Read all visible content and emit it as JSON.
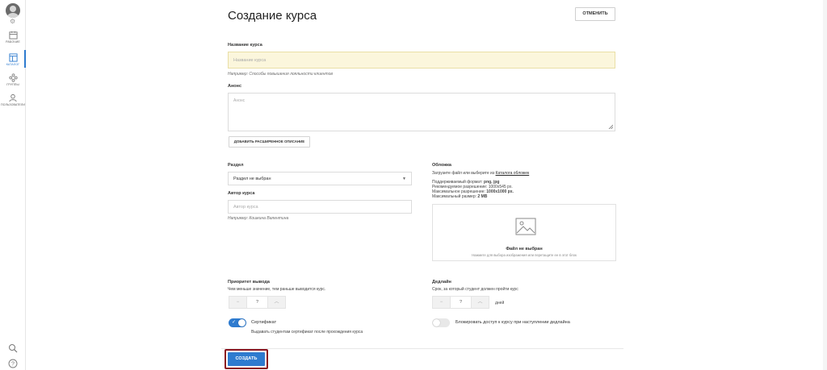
{
  "sidebar": {
    "items": [
      {
        "label": "РАБОЧИЕ",
        "icon": "calendar-icon"
      },
      {
        "label": "КАТАЛОГ",
        "icon": "catalog-icon",
        "active": true
      },
      {
        "label": "ГРУППЫ",
        "icon": "groups-icon"
      },
      {
        "label": "ПОЛЬЗОВАТЕЛИ",
        "icon": "users-icon"
      }
    ]
  },
  "header": {
    "title": "Создание курса",
    "cancel_label": "ОТМЕНИТЬ"
  },
  "course_name": {
    "label": "Название курса",
    "placeholder": "Название курса",
    "hint": "Например: Способы повышения лояльности клиентов"
  },
  "announce": {
    "label": "Анонс",
    "placeholder": "Анонс",
    "add_description_label": "ДОБАВИТЬ РАСШИРЕННОЕ ОПИСАНИЕ"
  },
  "section": {
    "label": "Раздел",
    "value": "Раздел не выбран"
  },
  "author": {
    "label": "Автор курса",
    "placeholder": "Автор курса",
    "hint": "Например: Кошкина Валентина"
  },
  "cover": {
    "label": "Обложка",
    "upload_text": "Загрузите файл или выберите из",
    "catalog_link": "Каталога обложек",
    "format_label": "Поддерживаемый формат:",
    "format_value": "png, jpg",
    "recommended": "Рекомендуемое разрешение: 1000х545 px.",
    "max_resolution_label": "Максимальное разрешение:",
    "max_resolution_value": "1000х1000 px.",
    "max_size_label": "Максимальный размер:",
    "max_size_value": "2 MB",
    "no_file": "Файл не выбран",
    "drop_hint": "Нажмите для выбора изображения или перетащите ее в этот блок"
  },
  "priority": {
    "label": "Приоритет вывода",
    "description": "Чем меньше значение, тем раньше выводится курс.",
    "value": "?"
  },
  "deadline": {
    "label": "Дедлайн",
    "description": "Срок, за который студент должен пройти курс",
    "value": "?",
    "unit": "дней"
  },
  "certificate": {
    "label": "Сертификат",
    "enabled": true,
    "description": "Выдавать студентам сертификат после прохождения курса"
  },
  "block_access": {
    "label": "Блокировать доступ к курсу при наступлении дедлайна",
    "enabled": false
  },
  "actions": {
    "create_label": "СОЗДАТЬ"
  },
  "colors": {
    "accent": "#2e7bcf",
    "highlight_input": "#fbf6dc",
    "focus_outline": "#8a1420"
  }
}
